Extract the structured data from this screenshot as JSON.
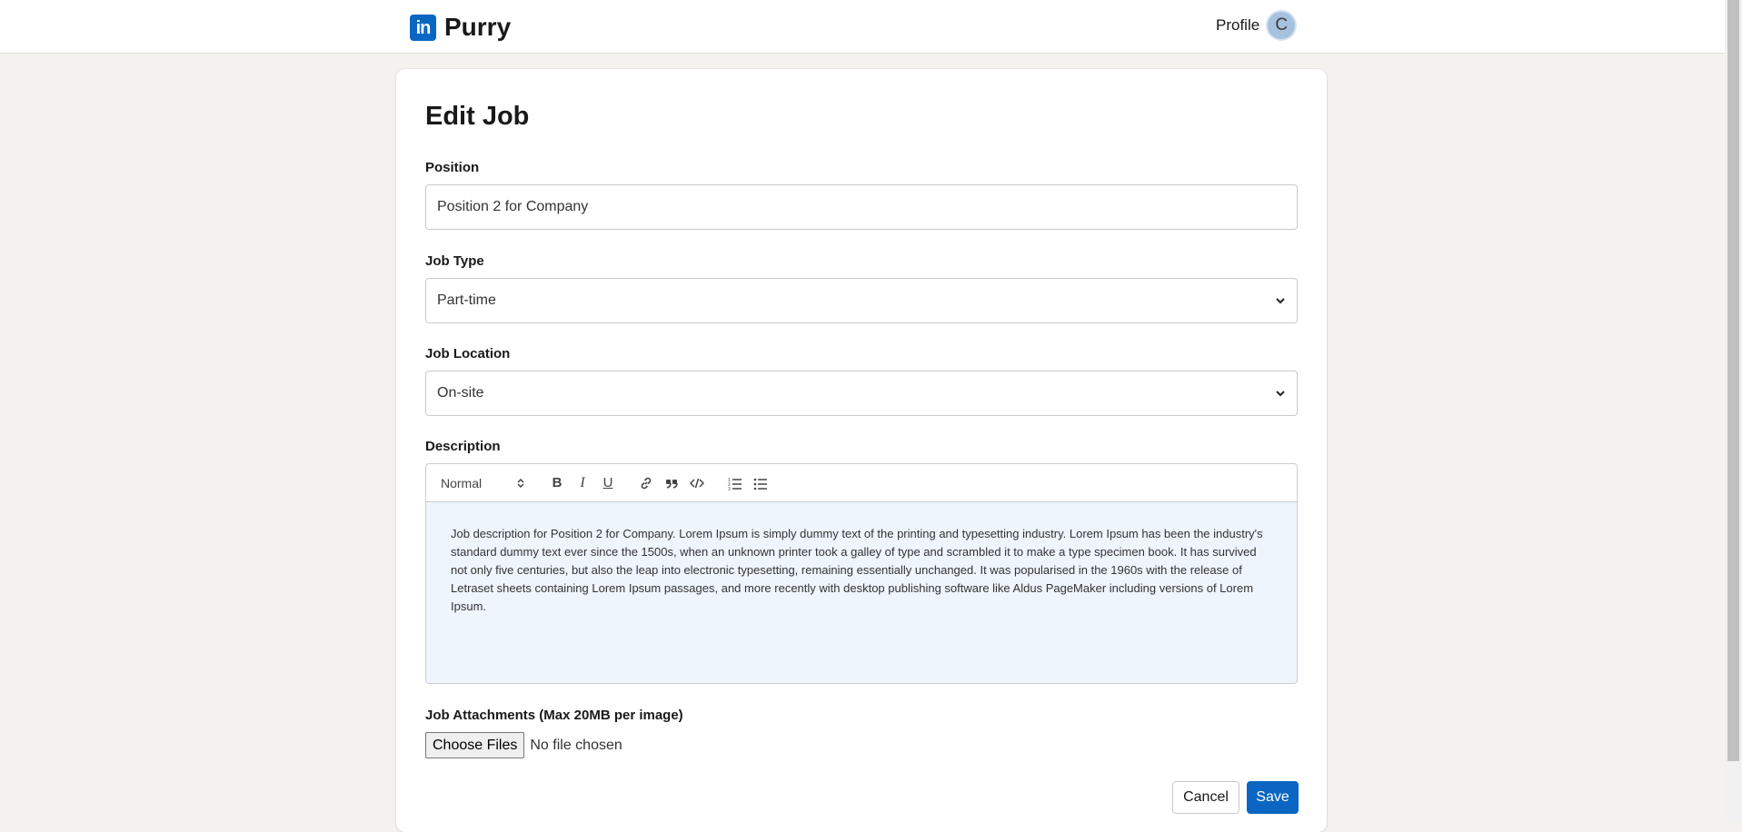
{
  "header": {
    "logo_text": "in",
    "brand": "Purry",
    "profile_label": "Profile",
    "avatar_initial": "C"
  },
  "form": {
    "title": "Edit Job",
    "position": {
      "label": "Position",
      "value": "Position 2 for Company"
    },
    "job_type": {
      "label": "Job Type",
      "value": "Part-time"
    },
    "job_location": {
      "label": "Job Location",
      "value": "On-site"
    },
    "description": {
      "label": "Description",
      "toolbar": {
        "heading_select": "Normal",
        "bold": "B",
        "italic": "I",
        "underline": "U"
      },
      "text": "Job description for Position 2 for Company. Lorem Ipsum is simply dummy text of the printing and typesetting industry. Lorem Ipsum has been the industry's standard dummy text ever since the 1500s, when an unknown printer took a galley of type and scrambled it to make a type specimen book. It has survived not only five centuries, but also the leap into electronic typesetting, remaining essentially unchanged. It was popularised in the 1960s with the release of Letraset sheets containing Lorem Ipsum passages, and more recently with desktop publishing software like Aldus PageMaker including versions of Lorem Ipsum."
    },
    "attachments": {
      "label": "Job Attachments (Max 20MB per image)",
      "button": "Choose Files",
      "status": "No file chosen"
    },
    "actions": {
      "cancel": "Cancel",
      "save": "Save"
    }
  },
  "colors": {
    "brand_blue": "#0a66c2",
    "page_background": "#f3f2ef",
    "editor_background": "#eef5fd"
  }
}
